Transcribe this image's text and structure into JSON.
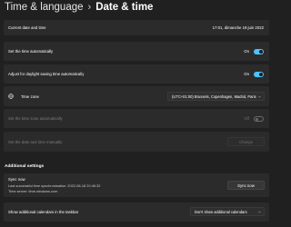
{
  "breadcrumb": {
    "parent": "Time & language",
    "separator": "›",
    "current": "Date & time"
  },
  "current": {
    "label": "Current date and time",
    "value": "17:01, dimanche 19 juin 2022"
  },
  "set_auto_time": {
    "label": "Set the time automatically",
    "state": "On"
  },
  "dst": {
    "label": "Adjust for daylight saving time automatically",
    "state": "On"
  },
  "time_zone": {
    "label": "Time zone",
    "icon": "globe-icon",
    "selected": "(UTC+01:00) Brussels, Copenhagen, Madrid, Paris"
  },
  "set_auto_tz": {
    "label": "Set the time zone automatically",
    "state": "Off"
  },
  "manual": {
    "label": "Set the date and time manually",
    "button": "Change"
  },
  "additional": {
    "heading": "Additional settings",
    "sync": {
      "title": "Sync now",
      "last": "Last successful time synchronisation: 2022-06-18 20:46:32",
      "server": "Time server: time.windows.com",
      "button": "Sync now"
    },
    "calendars": {
      "label": "Show additional calendars in the taskbar",
      "selected": "Don't show additional calendars"
    }
  },
  "colors": {
    "accent": "#4cc2ff",
    "background": "#202020",
    "card": "#2b2b2b"
  }
}
